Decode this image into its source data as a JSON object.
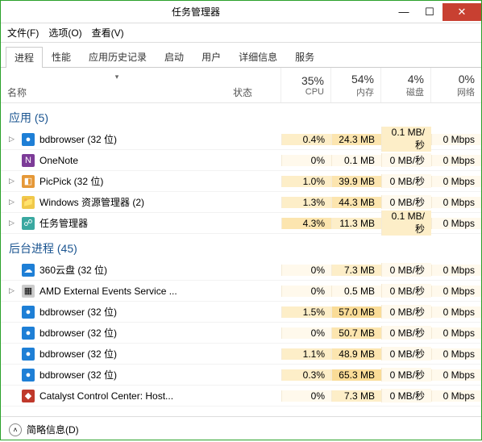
{
  "window": {
    "title": "任务管理器"
  },
  "menu": {
    "file": "文件(F)",
    "options": "选项(O)",
    "view": "查看(V)"
  },
  "tabs": [
    "进程",
    "性能",
    "应用历史记录",
    "启动",
    "用户",
    "详细信息",
    "服务"
  ],
  "active_tab": 0,
  "columns": {
    "name": "名称",
    "status": "状态",
    "metrics": [
      {
        "pct": "35%",
        "label": "CPU"
      },
      {
        "pct": "54%",
        "label": "内存"
      },
      {
        "pct": "4%",
        "label": "磁盘"
      },
      {
        "pct": "0%",
        "label": "网络"
      }
    ]
  },
  "groups": [
    {
      "title": "应用 (5)",
      "rows": [
        {
          "exp": true,
          "icon": "icn-blue",
          "glyph": "●",
          "name": "bdbrowser (32 位)",
          "cpu": "0.4%",
          "mem": "24.3 MB",
          "disk": "0.1 MB/秒",
          "net": "0 Mbps",
          "h": [
            1,
            2,
            1,
            0
          ]
        },
        {
          "exp": false,
          "icon": "icn-purple",
          "glyph": "N",
          "name": "OneNote",
          "cpu": "0%",
          "mem": "0.1 MB",
          "disk": "0 MB/秒",
          "net": "0 Mbps",
          "h": [
            0,
            0,
            0,
            0
          ]
        },
        {
          "exp": true,
          "icon": "icn-orange",
          "glyph": "◧",
          "name": "PicPick (32 位)",
          "cpu": "1.0%",
          "mem": "39.9 MB",
          "disk": "0 MB/秒",
          "net": "0 Mbps",
          "h": [
            1,
            2,
            0,
            0
          ]
        },
        {
          "exp": true,
          "icon": "icn-yellow",
          "glyph": "📁",
          "name": "Windows 资源管理器 (2)",
          "cpu": "1.3%",
          "mem": "44.3 MB",
          "disk": "0 MB/秒",
          "net": "0 Mbps",
          "h": [
            1,
            2,
            0,
            0
          ]
        },
        {
          "exp": true,
          "icon": "icn-teal",
          "glyph": "☍",
          "name": "任务管理器",
          "cpu": "4.3%",
          "mem": "11.3 MB",
          "disk": "0.1 MB/秒",
          "net": "0 Mbps",
          "h": [
            2,
            1,
            1,
            0
          ]
        }
      ]
    },
    {
      "title": "后台进程 (45)",
      "rows": [
        {
          "exp": false,
          "icon": "icn-blue",
          "glyph": "☁",
          "name": "360云盘 (32 位)",
          "cpu": "0%",
          "mem": "7.3 MB",
          "disk": "0 MB/秒",
          "net": "0 Mbps",
          "h": [
            0,
            1,
            0,
            0
          ]
        },
        {
          "exp": true,
          "icon": "icn-grey",
          "glyph": "▦",
          "name": "AMD External Events Service ...",
          "cpu": "0%",
          "mem": "0.5 MB",
          "disk": "0 MB/秒",
          "net": "0 Mbps",
          "h": [
            0,
            0,
            0,
            0
          ]
        },
        {
          "exp": false,
          "icon": "icn-blue",
          "glyph": "●",
          "name": "bdbrowser (32 位)",
          "cpu": "1.5%",
          "mem": "57.0 MB",
          "disk": "0 MB/秒",
          "net": "0 Mbps",
          "h": [
            1,
            3,
            0,
            0
          ]
        },
        {
          "exp": false,
          "icon": "icn-blue",
          "glyph": "●",
          "name": "bdbrowser (32 位)",
          "cpu": "0%",
          "mem": "50.7 MB",
          "disk": "0 MB/秒",
          "net": "0 Mbps",
          "h": [
            0,
            2,
            0,
            0
          ]
        },
        {
          "exp": false,
          "icon": "icn-blue",
          "glyph": "●",
          "name": "bdbrowser (32 位)",
          "cpu": "1.1%",
          "mem": "48.9 MB",
          "disk": "0 MB/秒",
          "net": "0 Mbps",
          "h": [
            1,
            2,
            0,
            0
          ]
        },
        {
          "exp": false,
          "icon": "icn-blue",
          "glyph": "●",
          "name": "bdbrowser (32 位)",
          "cpu": "0.3%",
          "mem": "65.3 MB",
          "disk": "0 MB/秒",
          "net": "0 Mbps",
          "h": [
            1,
            3,
            0,
            0
          ]
        },
        {
          "exp": false,
          "icon": "icn-red",
          "glyph": "◆",
          "name": "Catalyst Control Center: Host...",
          "cpu": "0%",
          "mem": "7.3 MB",
          "disk": "0 MB/秒",
          "net": "0 Mbps",
          "h": [
            0,
            1,
            0,
            0
          ]
        }
      ]
    }
  ],
  "statusbar": {
    "label": "简略信息(D)"
  }
}
